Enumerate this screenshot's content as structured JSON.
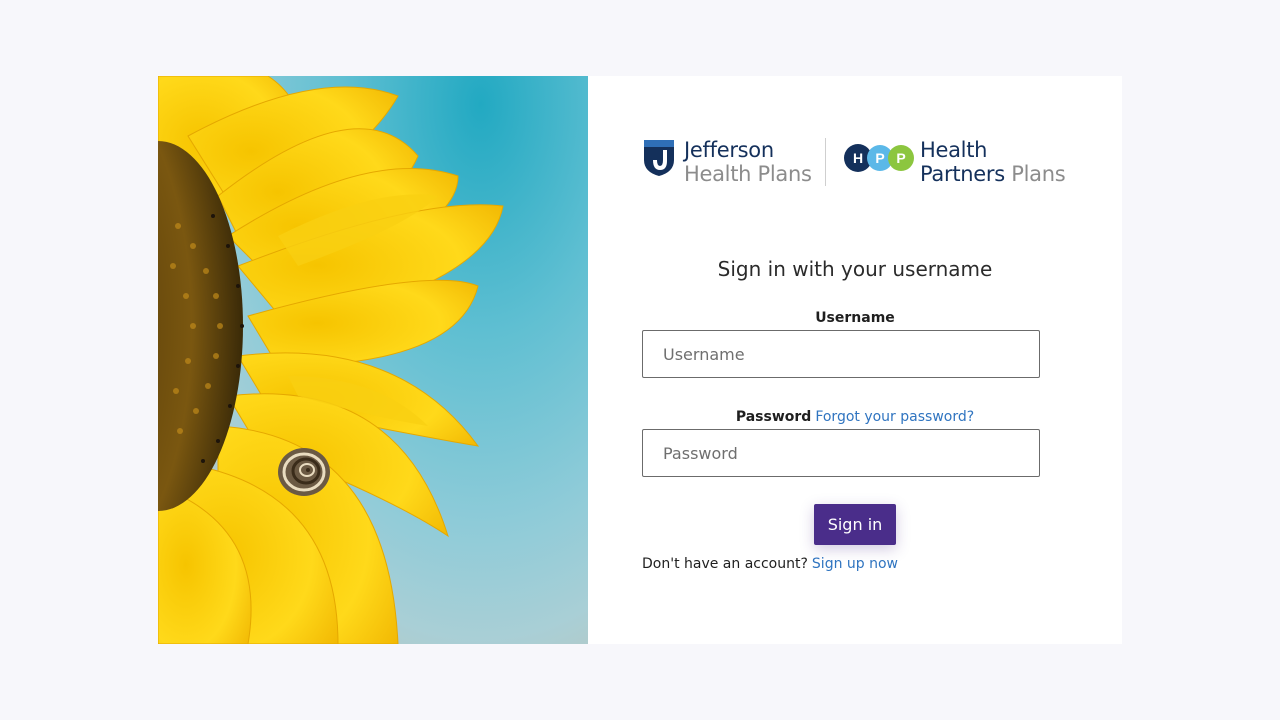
{
  "hero_image": {
    "description_name": "sunflower-with-snail"
  },
  "logos": {
    "jefferson": {
      "line1": "Jefferson",
      "line2": "Health Plans"
    },
    "hpp": {
      "letters": [
        "H",
        "P",
        "P"
      ],
      "line1": "Health",
      "line2a": "Partners",
      "line2b": " Plans"
    }
  },
  "form": {
    "heading": "Sign in with your username",
    "username_label": "Username",
    "username_placeholder": "Username",
    "password_label": "Password",
    "forgot_link": "Forgot your password?",
    "password_placeholder": "Password",
    "signin_button": "Sign in",
    "no_account_text": "Don't have an account?",
    "signup_link": "Sign up now"
  },
  "colors": {
    "background": "#f7f7fb",
    "brand_navy": "#14305b",
    "button_purple": "#4a2d8a",
    "link_blue": "#2f74c0",
    "hpp_h": "#14305b",
    "hpp_p1": "#5bb8e8",
    "hpp_p2": "#8cc63f"
  }
}
